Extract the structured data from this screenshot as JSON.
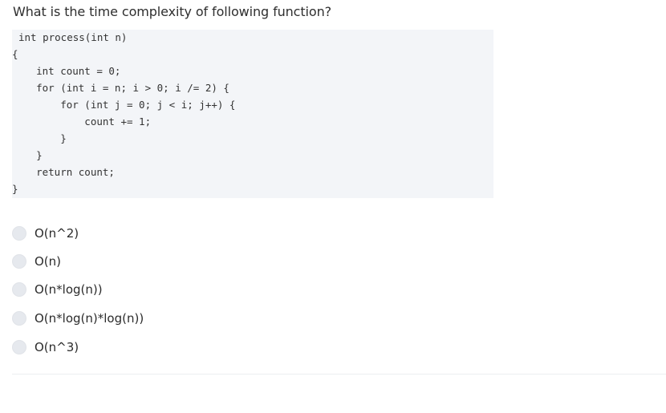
{
  "question": {
    "text": "What is the time complexity of following function?"
  },
  "code": {
    "lines": [
      "int process(int n)",
      "{",
      "    int count = 0;",
      "    for (int i = n; i > 0; i /= 2) {",
      "        for (int j = 0; j < i; j++) {",
      "            count += 1;",
      "        }",
      "    }",
      "    return count;",
      "}"
    ]
  },
  "options": [
    {
      "label": "O(n^2)",
      "selected": false
    },
    {
      "label": "O(n)",
      "selected": false
    },
    {
      "label": "O(n*log(n))",
      "selected": false
    },
    {
      "label": "O(n*log(n)*log(n))",
      "selected": false
    },
    {
      "label": "O(n^3)",
      "selected": false
    }
  ]
}
